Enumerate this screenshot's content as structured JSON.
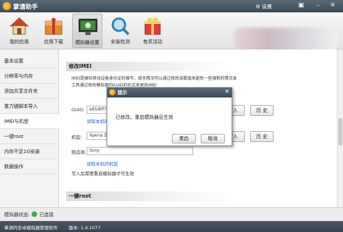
{
  "window": {
    "title": "掌请助手",
    "settings_label": "设置"
  },
  "toolbar": {
    "items": [
      {
        "label": "我的应用",
        "icon": "house-icon"
      },
      {
        "label": "应用下载",
        "icon": "gift-box-download-icon"
      },
      {
        "label": "模拟器设置",
        "icon": "monitor-settings-icon"
      },
      {
        "label": "安装检测",
        "icon": "magnifier-icon"
      },
      {
        "label": "有奖活动",
        "icon": "gift-icon"
      }
    ],
    "active_index": 2
  },
  "sidebar": {
    "items": [
      {
        "label": "基本设置"
      },
      {
        "label": "分辨率与内存"
      },
      {
        "label": "添加共享文件夹"
      },
      {
        "label": "重力键脚本导入"
      },
      {
        "label": "IMEI与机型"
      },
      {
        "label": "一键root"
      },
      {
        "label": "内存不足1G安装"
      },
      {
        "label": "数据操作"
      }
    ],
    "active_index": 4
  },
  "main": {
    "imei_section_title": "修改IMEI",
    "description": "IMEI是国际移动设备身份证的缩写，很多情况可以通过修改该数值来避免一些强制的情况本工具通过修改模拟器的GUID的形式来更改IMEI",
    "guid_label": "GUID:",
    "guid_value": "e65d0f75-7",
    "read_local_link_1": "读取本机的",
    "model_label": "机型:",
    "model_value": "Xperia Z2",
    "manufacturer_label": "制造商:",
    "manufacturer_value": "Sony",
    "read_local_model_link": "读取本机的机型",
    "restart_note": "写入后需要重启模拟器才可生效",
    "write_button": "写入",
    "history_button": "历 史",
    "root_section_title": "一键root"
  },
  "dialog": {
    "title": "提示",
    "message": "已修改，重启模拟器后生效",
    "restart_button": "重启",
    "cancel_button": "取消"
  },
  "status": {
    "label": "模拟器状态:",
    "connection": "已连接"
  },
  "footer": {
    "app_name": "掌请的安卓模拟器管理软件",
    "version": "版本: 1.4.1077"
  }
}
